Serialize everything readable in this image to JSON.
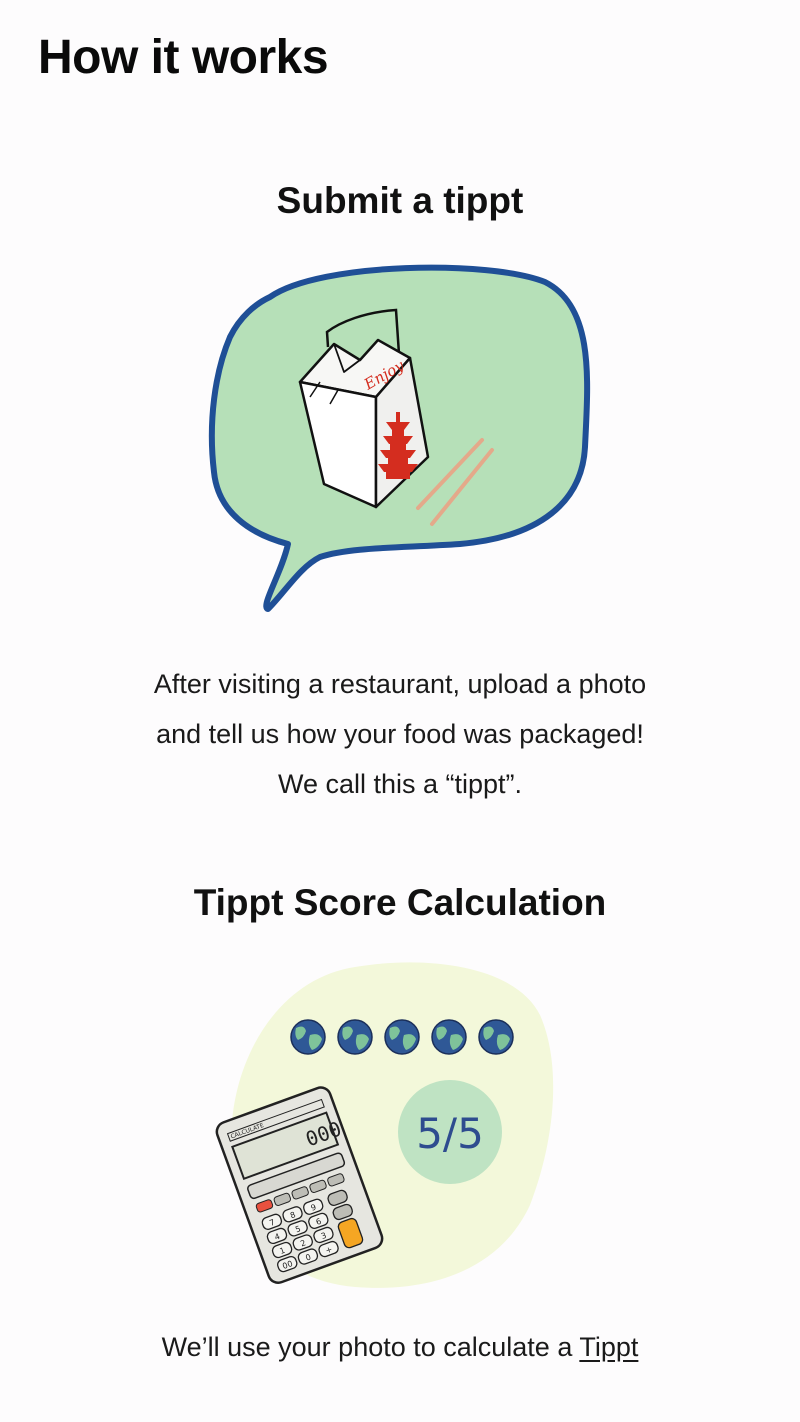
{
  "page": {
    "title": "How it works"
  },
  "sections": [
    {
      "title": "Submit a tippt",
      "illustration": {
        "icon": "takeout-box-speech-bubble-icon",
        "box_text": "Enjoy",
        "colors": {
          "bubble_fill": "#b6e0b8",
          "bubble_stroke": "#1f4f96",
          "box_text": "#d42d1f",
          "chopsticks": "#e4a98a"
        }
      },
      "description_lines": [
        "After visiting a restaurant, upload a photo",
        "and tell us how your food was packaged!",
        "We call this a “tippt”."
      ]
    },
    {
      "title": "Tippt Score Calculation",
      "illustration": {
        "icon": "calculator-score-icon",
        "globe_icon": "earth-globe-icon",
        "globe_count": 5,
        "score": "5/5",
        "calculator_brand": "CALCULATE",
        "calculator_keys": [
          "7",
          "8",
          "9",
          "4",
          "5",
          "6",
          "1",
          "2",
          "3",
          "00",
          "0",
          "+"
        ],
        "colors": {
          "backdrop": "#f3f8da",
          "score_circle": "#bfe3c3",
          "score_text": "#2e4c8f",
          "globe_ocean": "#2f5896",
          "globe_land": "#7fc39a",
          "calculator_accent": "#f5a623",
          "calculator_red_key": "#e8513f"
        }
      },
      "description_prefix": "We’ll use your photo  to calculate a ",
      "description_link": "Tippt"
    }
  ]
}
